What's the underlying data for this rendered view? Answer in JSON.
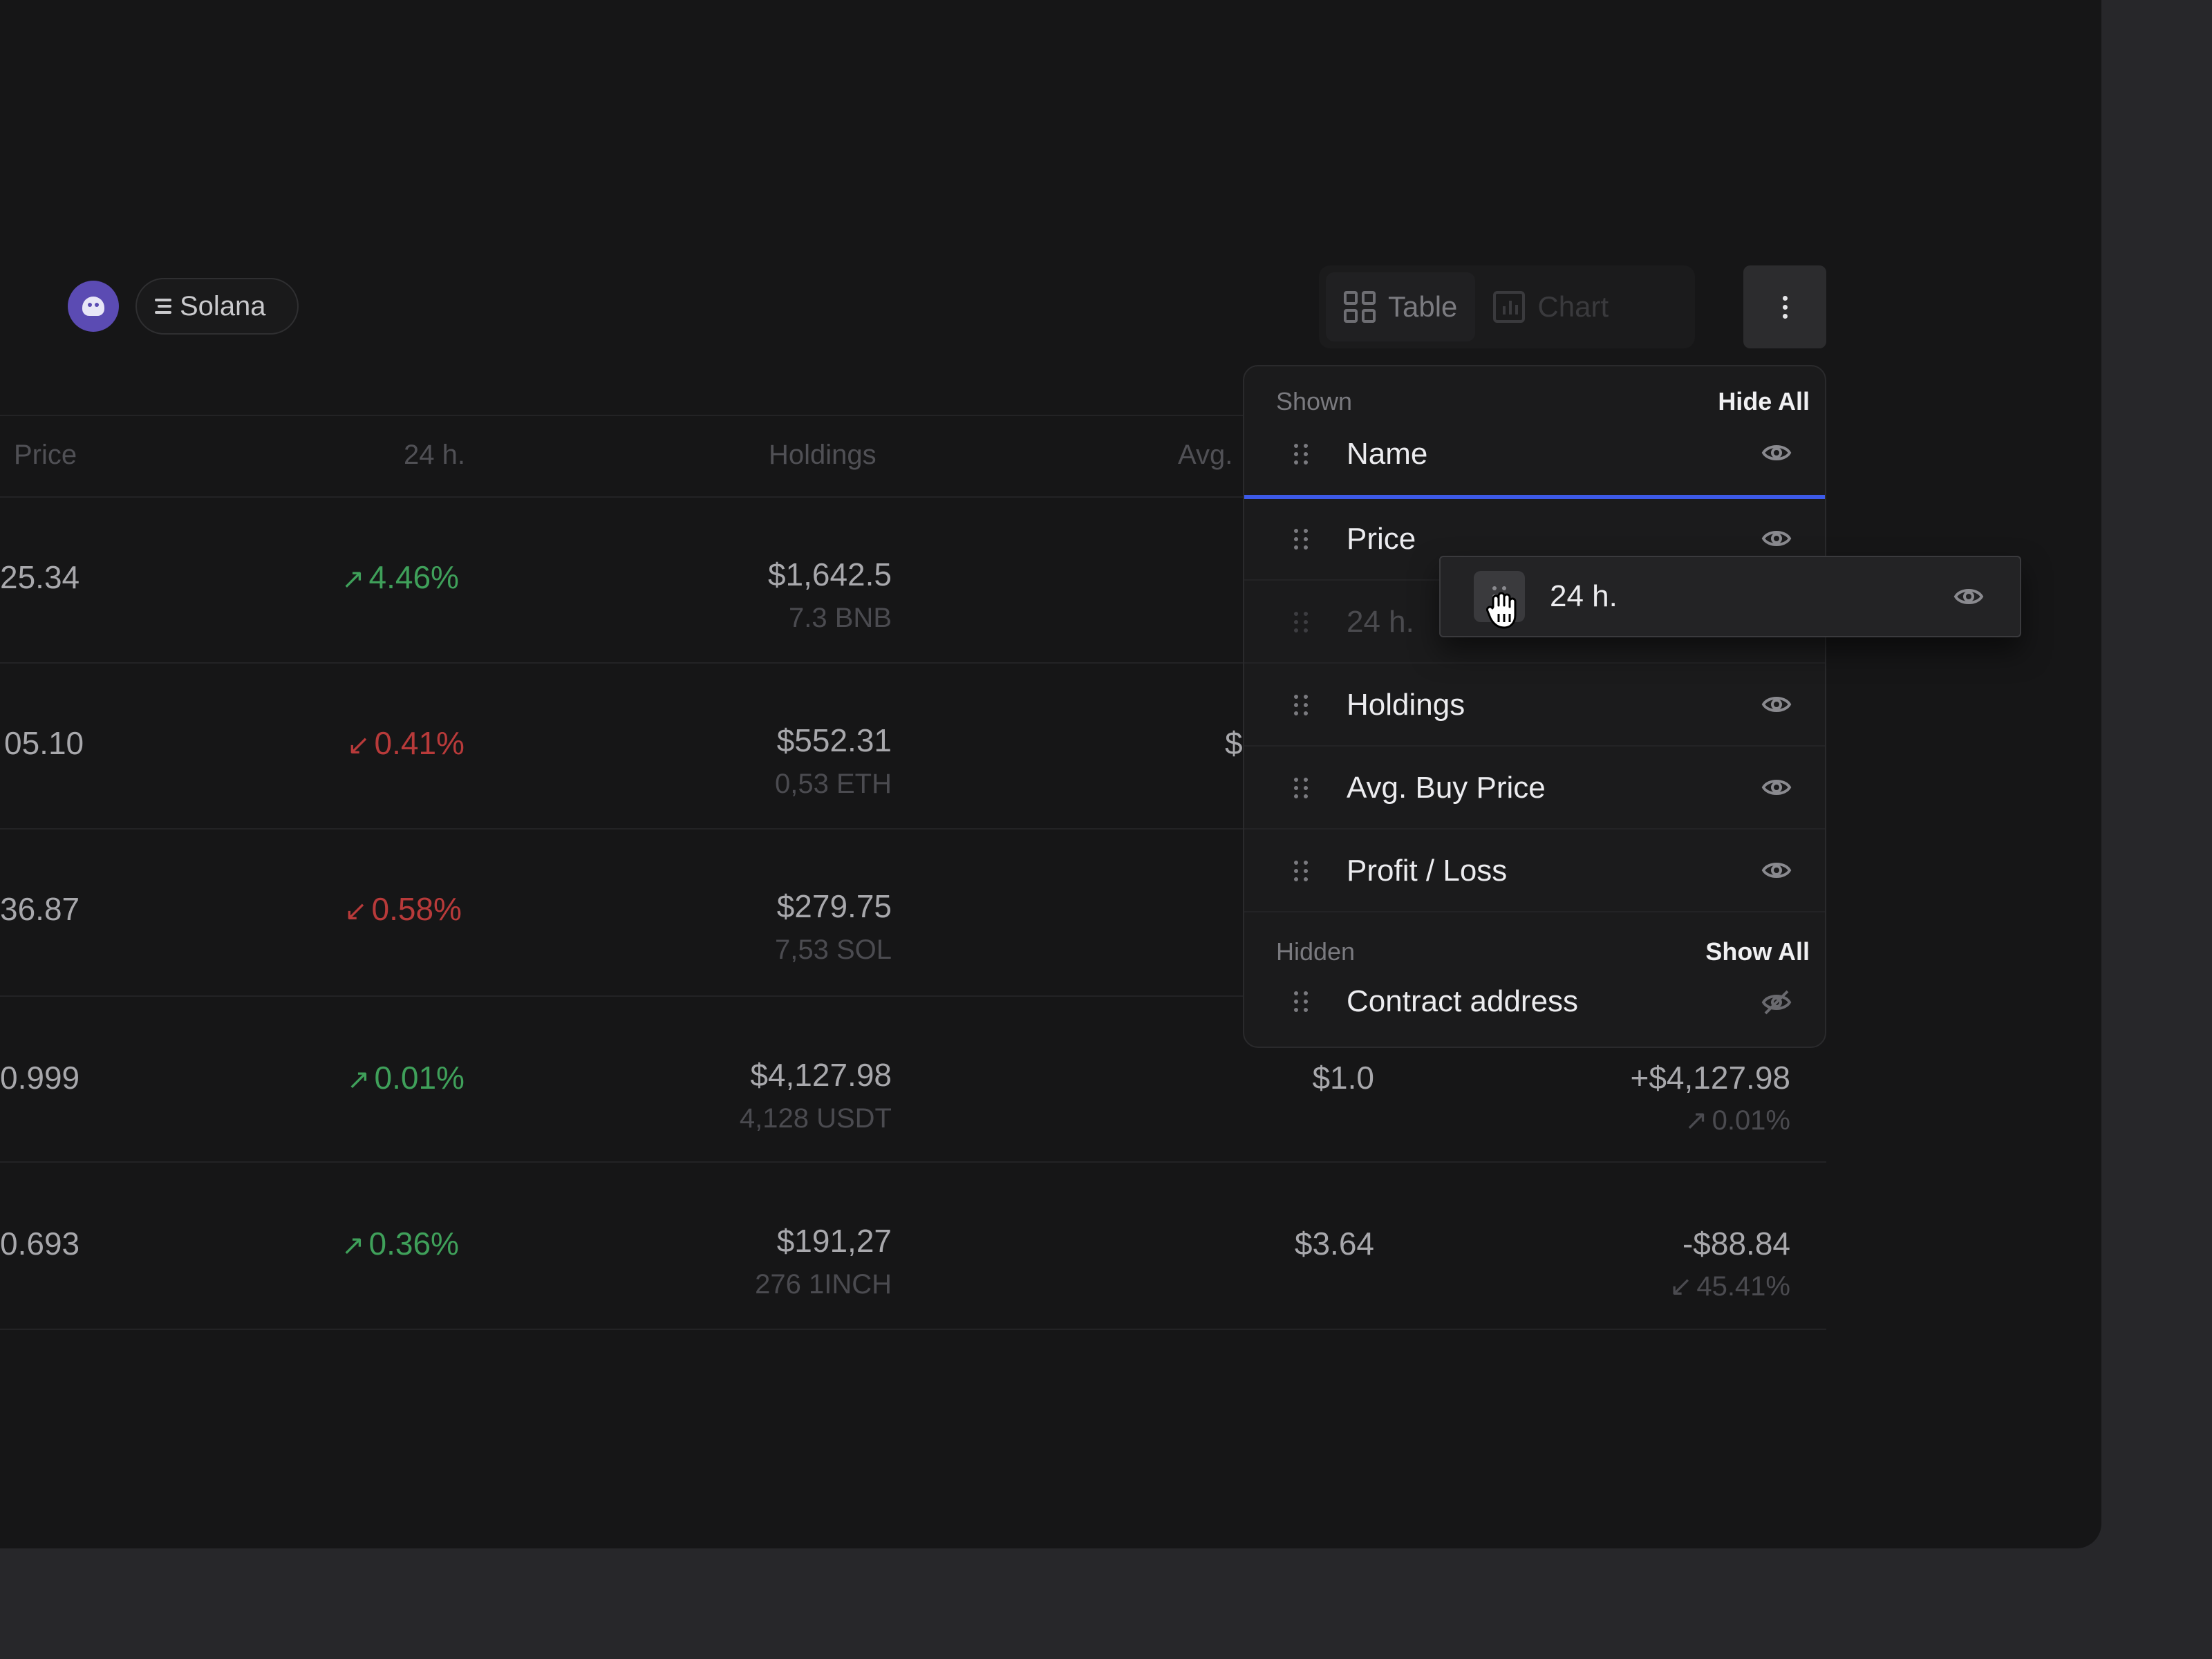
{
  "network_chip": {
    "label": "Solana"
  },
  "view_toggle": {
    "table_label": "Table",
    "chart_label": "Chart"
  },
  "table": {
    "headers": [
      "Price",
      "24 h.",
      "Holdings",
      "Avg."
    ],
    "rows": [
      {
        "price": "25.34",
        "change": "4.46%",
        "change_dir": "up",
        "holdings": "$1,642.5",
        "holdings_sub": "7.3 BNB",
        "avg": "",
        "pl": "",
        "pl_sub": ""
      },
      {
        "price": "05.10",
        "change": "0.41%",
        "change_dir": "down",
        "holdings": "$552.31",
        "holdings_sub": "0,53 ETH",
        "avg": "$",
        "pl": "",
        "pl_sub": ""
      },
      {
        "price": "36.87",
        "change": "0.58%",
        "change_dir": "down",
        "holdings": "$279.75",
        "holdings_sub": "7,53 SOL",
        "avg": "",
        "pl": "",
        "pl_sub": ""
      },
      {
        "price": "0.999",
        "change": "0.01%",
        "change_dir": "up",
        "holdings": "$4,127.98",
        "holdings_sub": "4,128 USDT",
        "avg": "$1.0",
        "pl": "+$4,127.98",
        "pl_sub": "0.01%"
      },
      {
        "price": "0.693",
        "change": "0.36%",
        "change_dir": "up",
        "holdings": "$191,27",
        "holdings_sub": "276 1INCH",
        "avg": "$3.64",
        "pl": "-$88.84",
        "pl_sub": "45.41%"
      }
    ]
  },
  "column_menu": {
    "shown_label": "Shown",
    "hide_all": "Hide All",
    "hidden_label": "Hidden",
    "show_all": "Show All",
    "shown_items": [
      "Name",
      "Price",
      "24 h.",
      "Holdings",
      "Avg. Buy Price",
      "Profit / Loss"
    ],
    "hidden_items": [
      "Contract address"
    ],
    "dragging_item": "24 h."
  },
  "colors": {
    "accent": "#3d5ae8",
    "up": "#3fa05a",
    "down": "#b83a3a"
  },
  "icons": [
    "grid-icon",
    "bar-chart-icon",
    "kebab-icon",
    "drag-handle-icon",
    "eye-icon",
    "eye-off-icon",
    "grab-cursor-icon"
  ]
}
